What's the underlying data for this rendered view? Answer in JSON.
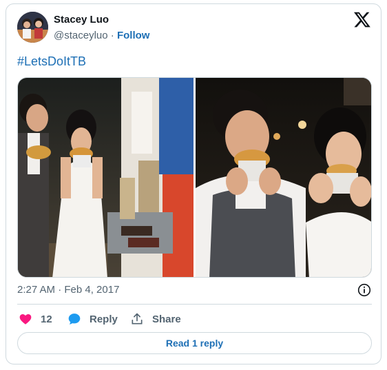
{
  "author": {
    "name": "Stacey Luo",
    "handle": "@staceyluo",
    "follow_label": "Follow"
  },
  "tweet": {
    "text": "#LetsDoItTB",
    "timestamp": "2:27 AM · Feb 4, 2017"
  },
  "actions": {
    "like_count": "12",
    "reply_label": "Reply",
    "share_label": "Share"
  },
  "read_reply_label": "Read 1 reply",
  "colors": {
    "link": "#1d6fb5",
    "heart": "#f91880",
    "reply_icon": "#1d9bf0",
    "secondary_text": "#536471",
    "border": "#cfd9de"
  },
  "icons": [
    "x-logo-icon",
    "info-icon",
    "heart-icon",
    "reply-bubble-icon",
    "share-icon"
  ]
}
